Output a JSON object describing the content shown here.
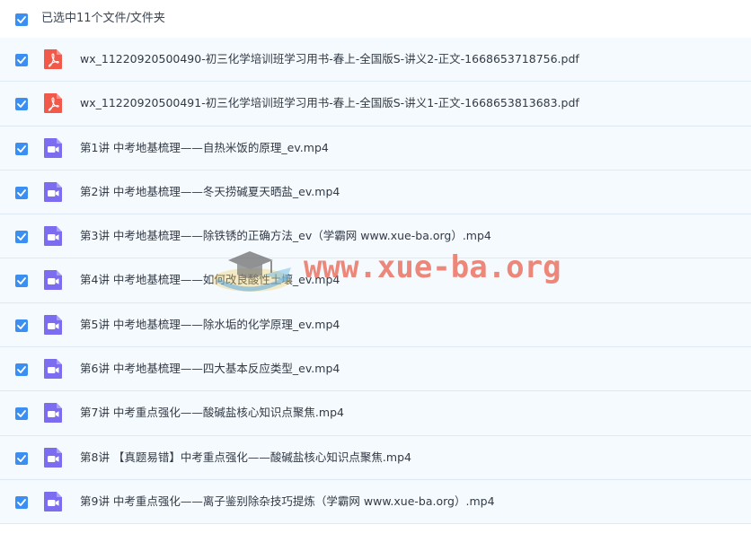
{
  "selection": {
    "summary": "已选中11个文件/文件夹",
    "checked": true
  },
  "files": [
    {
      "name": "wx_11220920500490-初三化学培训班学习用书-春上-全国版S-讲义2-正文-1668653718756.pdf",
      "type": "pdf",
      "icon": "pdf-icon",
      "checked": true
    },
    {
      "name": "wx_11220920500491-初三化学培训班学习用书-春上-全国版S-讲义1-正文-1668653813683.pdf",
      "type": "pdf",
      "icon": "pdf-icon",
      "checked": true
    },
    {
      "name": "第1讲 中考地基梳理——自热米饭的原理_ev.mp4",
      "type": "video",
      "icon": "video-icon",
      "checked": true
    },
    {
      "name": "第2讲 中考地基梳理——冬天捞碱夏天晒盐_ev.mp4",
      "type": "video",
      "icon": "video-icon",
      "checked": true
    },
    {
      "name": "第3讲 中考地基梳理——除铁锈的正确方法_ev（学霸网 www.xue-ba.org）.mp4",
      "type": "video",
      "icon": "video-icon",
      "checked": true
    },
    {
      "name": "第4讲 中考地基梳理——如何改良酸性土壤_ev.mp4",
      "type": "video",
      "icon": "video-icon",
      "checked": true
    },
    {
      "name": "第5讲 中考地基梳理——除水垢的化学原理_ev.mp4",
      "type": "video",
      "icon": "video-icon",
      "checked": true
    },
    {
      "name": "第6讲 中考地基梳理——四大基本反应类型_ev.mp4",
      "type": "video",
      "icon": "video-icon",
      "checked": true
    },
    {
      "name": "第7讲 中考重点强化——酸碱盐核心知识点聚焦.mp4",
      "type": "video",
      "icon": "video-icon",
      "checked": true
    },
    {
      "name": "第8讲 【真题易错】中考重点强化——酸碱盐核心知识点聚焦.mp4",
      "type": "video",
      "icon": "video-icon",
      "checked": true
    },
    {
      "name": "第9讲 中考重点强化——离子鉴别除杂技巧提炼（学霸网 www.xue-ba.org）.mp4",
      "type": "video",
      "icon": "video-icon",
      "checked": true
    }
  ],
  "watermark": {
    "text": "www.xue-ba.org",
    "icon": "graduation-cap-logo-icon"
  },
  "colors": {
    "checkbox": "#3b8ff2",
    "pdf": "#f15a4a",
    "video": "#7b6cf0",
    "row_bg": "#f5fafe",
    "watermark": "#e8604c"
  }
}
